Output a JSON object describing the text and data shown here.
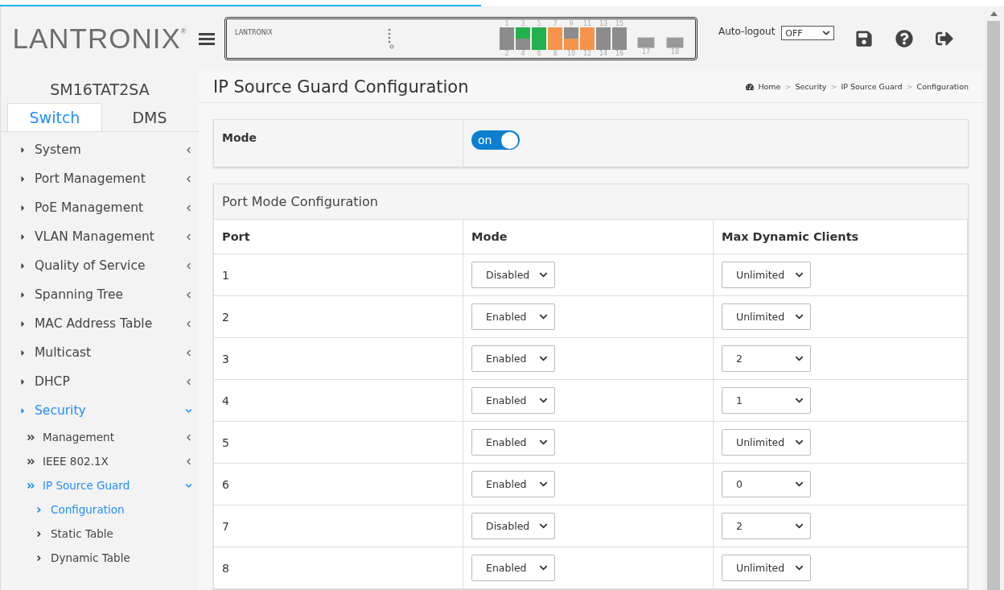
{
  "header": {
    "logo": "LANTRONIX",
    "logo_mark": "®",
    "device_logo": "LANTRONIX",
    "ports": [
      {
        "label": "1",
        "color": "#8c8c8c"
      },
      {
        "label": "2",
        "color": "#8c8c8c"
      },
      {
        "label": "3",
        "color": "#22b14c"
      },
      {
        "label": "4",
        "color": "#8c8c8c"
      },
      {
        "label": "5",
        "color": "#22b14c"
      },
      {
        "label": "6",
        "color": "#22b14c"
      },
      {
        "label": "7",
        "color": "#f7944a"
      },
      {
        "label": "8",
        "color": "#f7944a"
      },
      {
        "label": "9",
        "color": "#8c8c8c"
      },
      {
        "label": "10",
        "color": "#f7944a"
      },
      {
        "label": "11",
        "color": "#f7944a"
      },
      {
        "label": "12",
        "color": "#f7944a"
      },
      {
        "label": "13",
        "color": "#8c8c8c"
      },
      {
        "label": "14",
        "color": "#8c8c8c"
      },
      {
        "label": "15",
        "color": "#8c8c8c"
      },
      {
        "label": "16",
        "color": "#8c8c8c"
      }
    ],
    "sfp_ports": [
      "17",
      "18"
    ],
    "auto_logout": {
      "label": "Auto-logout",
      "value": "OFF"
    },
    "progress": {
      "level": 0.49
    }
  },
  "sidebar": {
    "device": "SM16TAT2SA",
    "tabs": [
      {
        "label": "Switch",
        "selected": true
      },
      {
        "label": "DMS",
        "selected": false
      }
    ],
    "items": [
      {
        "label": "System",
        "expanded": false,
        "selected": false
      },
      {
        "label": "Port Management",
        "expanded": false,
        "selected": false
      },
      {
        "label": "PoE Management",
        "expanded": false,
        "selected": false
      },
      {
        "label": "VLAN Management",
        "expanded": false,
        "selected": false
      },
      {
        "label": "Quality of Service",
        "expanded": false,
        "selected": false
      },
      {
        "label": "Spanning Tree",
        "expanded": false,
        "selected": false
      },
      {
        "label": "MAC Address Table",
        "expanded": false,
        "selected": false
      },
      {
        "label": "Multicast",
        "expanded": false,
        "selected": false
      },
      {
        "label": "DHCP",
        "expanded": false,
        "selected": false
      },
      {
        "label": "Security",
        "expanded": true,
        "selected": true,
        "children": [
          {
            "label": "Management",
            "expanded": false,
            "selected": false
          },
          {
            "label": "IEEE 802.1X",
            "expanded": false,
            "selected": false
          },
          {
            "label": "IP Source Guard",
            "expanded": true,
            "selected": true,
            "children": [
              {
                "label": "Configuration",
                "selected": true
              },
              {
                "label": "Static Table",
                "selected": false
              },
              {
                "label": "Dynamic Table",
                "selected": false
              }
            ]
          }
        ]
      }
    ]
  },
  "page": {
    "title": "IP Source Guard Configuration",
    "breadcrumb_separator": ">",
    "breadcrumb": [
      "Home",
      "Security",
      "IP Source Guard",
      "Configuration"
    ],
    "mode": {
      "label": "Mode",
      "on": true,
      "text": "on"
    },
    "port_section": {
      "title": "Port Mode Configuration",
      "columns": [
        "Port",
        "Mode",
        "Max Dynamic Clients"
      ],
      "rows": [
        {
          "port": "1",
          "mode": "Disabled",
          "max": "Unlimited"
        },
        {
          "port": "2",
          "mode": "Enabled",
          "max": "Unlimited"
        },
        {
          "port": "3",
          "mode": "Enabled",
          "max": "2"
        },
        {
          "port": "4",
          "mode": "Enabled",
          "max": "1"
        },
        {
          "port": "5",
          "mode": "Enabled",
          "max": "Unlimited"
        },
        {
          "port": "6",
          "mode": "Enabled",
          "max": "0"
        },
        {
          "port": "7",
          "mode": "Disabled",
          "max": "2"
        },
        {
          "port": "8",
          "mode": "Enabled",
          "max": "Unlimited"
        }
      ]
    }
  }
}
